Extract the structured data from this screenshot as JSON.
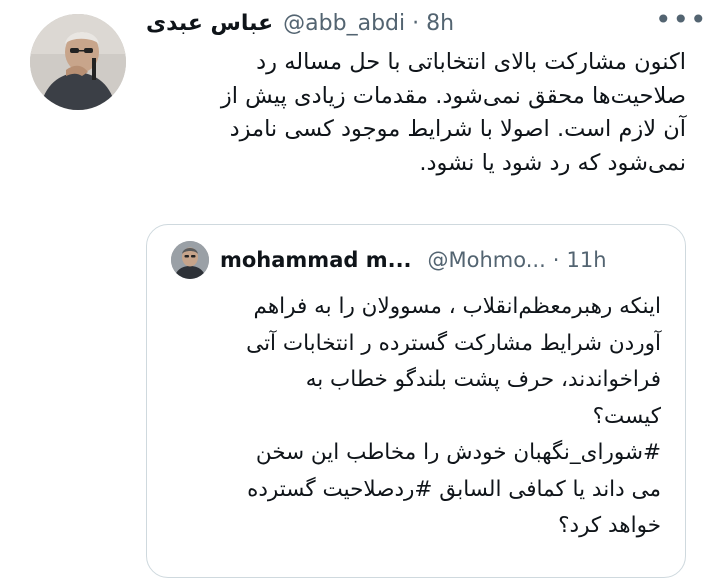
{
  "tweet": {
    "author": {
      "display_name": "عباس عبدی",
      "handle": "@abb_abdi",
      "separator": "·",
      "time": "8h"
    },
    "more_menu": "•••",
    "body_lines": [
      "اکنون مشارکت بالای انتخاباتی با حل مساله رد",
      "صلاحیت‌ها محقق نمی‌شود. مقدمات زیادی پیش از",
      "آن لازم است. اصولا با شرایط موجود کسی نامزد",
      "نمی‌شود که رد شود یا نشود."
    ]
  },
  "quoted_tweet": {
    "author": {
      "display_name": "mohammad m...",
      "handle": "@Mohmo...",
      "separator": "·",
      "time": "11h"
    },
    "body_lines": [
      "اینکه رهبرمعظم‌انقلاب ، مسوولان را به فراهم",
      "آوردن شرایط مشارکت گسترده   ر انتخابات آتی",
      "فراخواندند، حرف پشت بلندگو خطاب به",
      "کیست؟",
      "#شورای_نگهبان خودش را مخاطب این سخن",
      "می داند یا کمافی السابق #ردصلاحیت گسترده",
      "خواهد کرد؟"
    ]
  },
  "colors": {
    "text_primary": "#0f1419",
    "text_secondary": "#536471",
    "border": "#cfd9de"
  }
}
